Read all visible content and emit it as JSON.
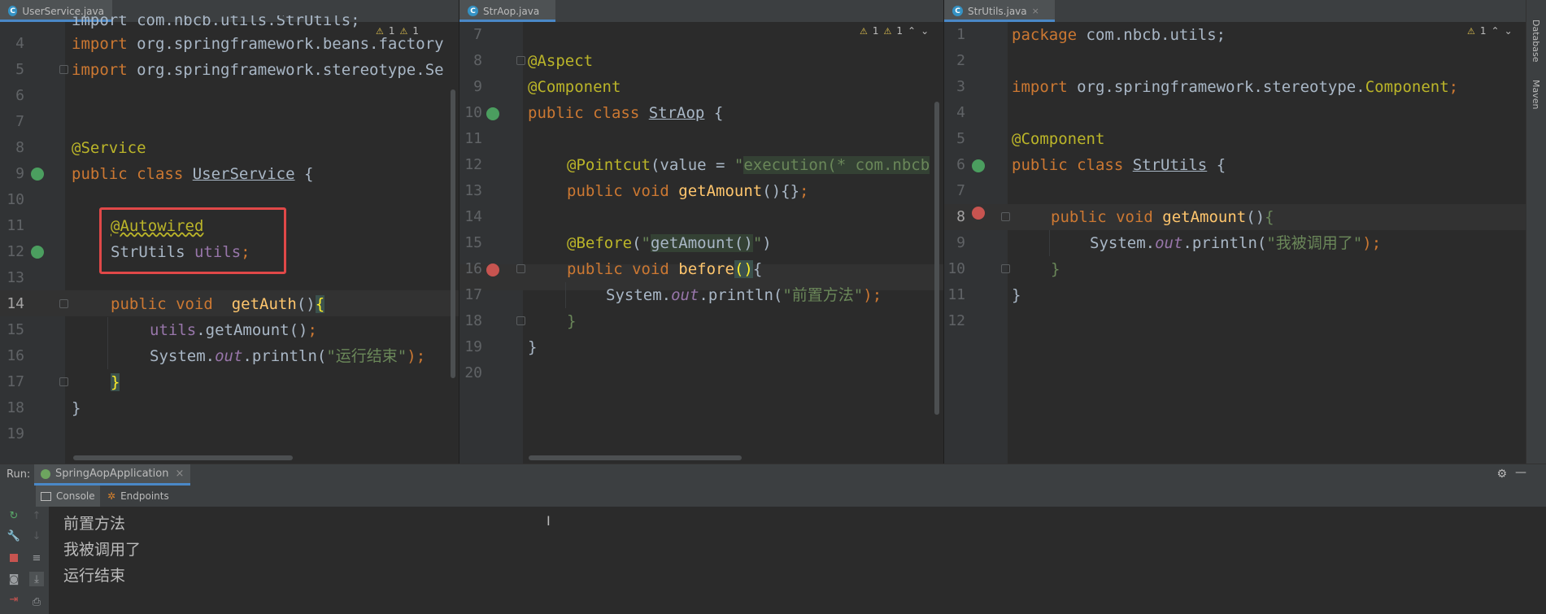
{
  "panes": [
    {
      "tab": {
        "title": "UserService.java",
        "icon": "C"
      },
      "inspections": {
        "warn1": "1",
        "warn2": "1"
      },
      "line_numbers": [
        "4",
        "5",
        "6",
        "7",
        "8",
        "9",
        "10",
        "11",
        "12",
        "13",
        "14",
        "15",
        "16",
        "17",
        "18",
        "19"
      ],
      "top_partial": "import com.nbcb.utils.StrUtils;",
      "code": {
        "l4_kw": "import",
        "l4_rest": " org.springframework.beans.factory",
        "l5_kw": "import",
        "l5_rest": " org.springframework.stereotype.Se",
        "l8_ann": "@Service",
        "l9_kw": "public class",
        "l9_cls": "UserService",
        "l9_rest": " {",
        "l11_ann": "@Autowired",
        "l12_type": "StrUtils",
        "l12_fld": "utils",
        "l12_semi": ";",
        "l14_kw": "public void",
        "l14_fn": "getAuth",
        "l14_paren": "()",
        "l14_brace": "{",
        "l15_fld": "utils",
        "l15_rest": ".getAmount()",
        "l15_semi": ";",
        "l16_a": "System.",
        "l16_out": "out",
        "l16_b": ".println(",
        "l16_str": "\"运行结束\"",
        "l16_c": ");",
        "l17_brace": "}",
        "l18_brace": "}"
      }
    },
    {
      "tab": {
        "title": "StrAop.java",
        "icon": "C"
      },
      "inspections": {
        "warn1": "1",
        "warn2": "1"
      },
      "line_numbers": [
        "7",
        "8",
        "9",
        "10",
        "11",
        "12",
        "13",
        "14",
        "15",
        "16",
        "17",
        "18",
        "19",
        "20"
      ],
      "code": {
        "l8_ann": "@Aspect",
        "l9_ann": "@Component",
        "l10_kw": "public class",
        "l10_cls": "StrAop",
        "l10_rest": " {",
        "l12_ann": "@Pointcut",
        "l12_a": "(value = ",
        "l12_q": "\"",
        "l12_str": "execution(* com.nbcb",
        "l13_kw": "public void",
        "l13_fn": "getAmount",
        "l13_rest": "(){}",
        "l13_semi": ";",
        "l15_ann": "@Before",
        "l15_a": "(",
        "l15_str1": "\"",
        "l15_str": "getAmount()",
        "l15_str2": "\"",
        "l15_b": ")",
        "l16_kw": "public void",
        "l16_fn": "before",
        "l16_paren": "()",
        "l16_brace": "{",
        "l17_a": "System.",
        "l17_out": "out",
        "l17_b": ".println(",
        "l17_str": "\"前置方法\"",
        "l17_c": ");",
        "l18_brace": "}",
        "l19_brace": "}"
      }
    },
    {
      "tab": {
        "title": "StrUtils.java",
        "icon": "C"
      },
      "inspections": {
        "warn1": "1"
      },
      "line_numbers": [
        "1",
        "2",
        "3",
        "4",
        "5",
        "6",
        "7",
        "8",
        "9",
        "10",
        "11",
        "12"
      ],
      "code": {
        "l1_kw": "package",
        "l1_rest": " com.nbcb.utils;",
        "l3_kw": "import",
        "l3_rest": " org.springframework.stereotype.",
        "l3_cls": "Component",
        "l3_semi": ";",
        "l5_ann": "@Component",
        "l6_kw": "public class",
        "l6_cls": "StrUtils",
        "l6_rest": " {",
        "l8_kw": "public void",
        "l8_fn": "getAmount",
        "l8_paren": "()",
        "l8_brace": "{",
        "l9_a": "System.",
        "l9_out": "out",
        "l9_b": ".println(",
        "l9_str": "\"我被调用了\"",
        "l9_c": ");",
        "l10_brace": "}",
        "l11_brace": "}"
      }
    }
  ],
  "right_sidebar": {
    "database_label": "Database",
    "maven_label": "Maven"
  },
  "run": {
    "label": "Run:",
    "config_name": "SpringAopApplication",
    "close": "×",
    "tabs": [
      {
        "label": "Console"
      },
      {
        "label": "Endpoints"
      }
    ],
    "output": [
      "前置方法",
      "我被调用了",
      "运行结束"
    ]
  },
  "icons": {
    "gear": "settings-icon",
    "minimize": "minimize-icon"
  },
  "colors": {
    "keyword": "#cc7832",
    "annotation": "#bbb529",
    "string": "#6a8759",
    "field": "#9876aa",
    "method": "#ffc66d",
    "highlight_box": "#e04848",
    "tab_underline": "#4a88c7"
  }
}
